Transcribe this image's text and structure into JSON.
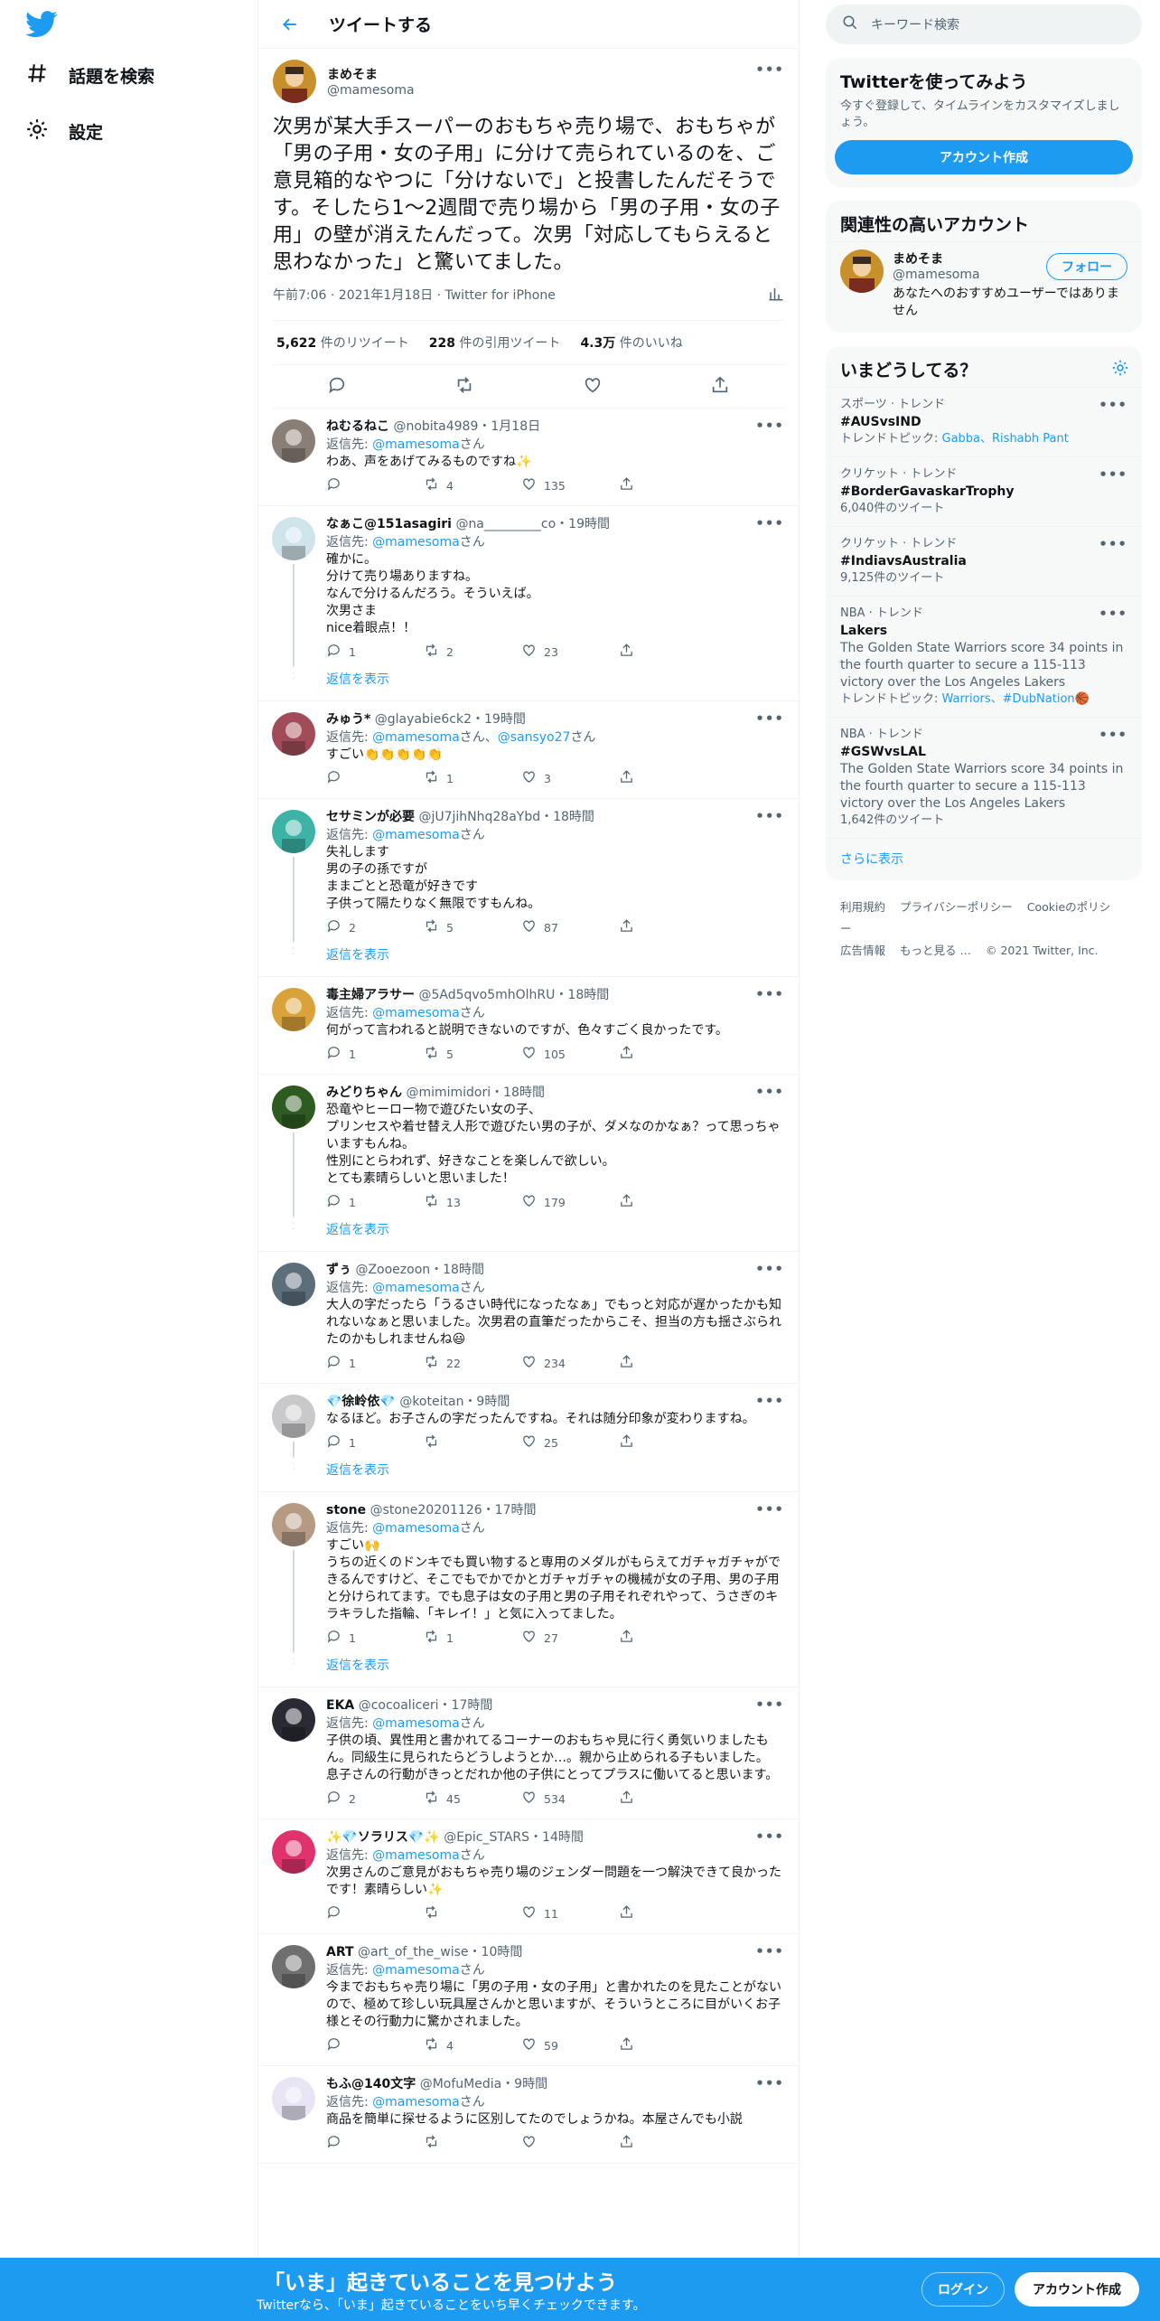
{
  "nav": {
    "explore_label": "話題を検索",
    "settings_label": "設定"
  },
  "header": {
    "title": "ツイートする"
  },
  "tweet": {
    "name": "まめそま",
    "handle": "@mamesoma",
    "text": "次男が某大手スーパーのおもちゃ売り場で、おもちゃが「男の子用・女の子用」に分けて売られているのを、ご意見箱的なやつに「分けないで」と投書したんだそうです。そしたら1〜2週間で売り場から「男の子用・女の子用」の壁が消えたんだって。次男「対応してもらえると思わなかった」と驚いてました。",
    "time": "午前7:06 · 2021年1月18日 · Twitter for iPhone",
    "retweets_count": "5,622",
    "retweets_label": "件のリツイート",
    "quotes_count": "228",
    "quotes_label": "件の引用ツイート",
    "likes_count": "4.3万",
    "likes_label": "件のいいね"
  },
  "replies": [
    {
      "name": "ねむるねこ",
      "handle": "@nobita4989",
      "time": "・1月18日",
      "reply_to": "返信先: @mamesomaさん",
      "text": "わあ、声をあげてみるものですね✨",
      "replies": "",
      "retweets": "4",
      "likes": "135",
      "show_more": ""
    },
    {
      "name": "なぁこ@151asagiri",
      "handle": "@na_________co",
      "time": "・19時間",
      "reply_to": "返信先: @mamesomaさん",
      "text": "確かに。\n分けて売り場ありますね。\nなんで分けるんだろう。そういえば。\n次男さま\nnice着眼点！！",
      "replies": "1",
      "retweets": "2",
      "likes": "23",
      "show_more": "返信を表示"
    },
    {
      "name": "みゅう*",
      "handle": "@glayabie6ck2",
      "time": "・19時間",
      "reply_to": "返信先: @mamesomaさん、@sansyo27さん",
      "text": "すごい👏👏👏👏👏",
      "replies": "",
      "retweets": "1",
      "likes": "3",
      "show_more": ""
    },
    {
      "name": "セサミンが必要",
      "handle": "@jU7jihNhq28aYbd",
      "time": "・18時間",
      "reply_to": "返信先: @mamesomaさん",
      "text": "失礼します\n男の子の孫ですが\nままごとと恐竜が好きです\n子供って隔たりなく無限ですもんね。",
      "replies": "2",
      "retweets": "5",
      "likes": "87",
      "show_more": "返信を表示"
    },
    {
      "name": "毒主婦アラサー",
      "handle": "@5Ad5qvo5mhOlhRU",
      "time": "・18時間",
      "reply_to": "返信先: @mamesomaさん",
      "text": "何がって言われると説明できないのですが、色々すごく良かったです。",
      "replies": "1",
      "retweets": "5",
      "likes": "105",
      "show_more": ""
    },
    {
      "name": "みどりちゃん",
      "handle": "@mimimidori",
      "time": "・18時間",
      "reply_to": "",
      "text": "恐竜やヒーロー物で遊びたい女の子、\nプリンセスや着せ替え人形で遊びたい男の子が、ダメなのかなぁ？って思っちゃいますもんね。\n性別にとらわれず、好きなことを楽しんで欲しい。\nとても素晴らしいと思いました！",
      "replies": "1",
      "retweets": "13",
      "likes": "179",
      "show_more": "返信を表示"
    },
    {
      "name": "ずぅ",
      "handle": "@Zooezoon",
      "time": "・18時間",
      "reply_to": "返信先: @mamesomaさん",
      "text": "大人の字だったら「うるさい時代になったなぁ」でもっと対応が遅かったかも知れないなぁと思いました。次男君の直筆だったからこそ、担当の方も揺さぶられたのかもしれませんね😃",
      "replies": "1",
      "retweets": "22",
      "likes": "234",
      "show_more": ""
    },
    {
      "name": "💎徐岭依💎",
      "handle": "@koteitan",
      "time": "・9時間",
      "reply_to": "",
      "text": "なるほど。お子さんの字だったんですね。それは随分印象が変わりますね。",
      "replies": "1",
      "retweets": "",
      "likes": "25",
      "show_more": "返信を表示"
    },
    {
      "name": "stone",
      "handle": "@stone20201126",
      "time": "・17時間",
      "reply_to": "返信先: @mamesomaさん",
      "text": "すごい🙌\nうちの近くのドンキでも買い物すると専用のメダルがもらえてガチャガチャができるんですけど、そこでもでかでかとガチャガチャの機械が女の子用、男の子用と分けられてます。でも息子は女の子用と男の子用それぞれやって、うさぎのキラキラした指輪、「キレイ！」と気に入ってました。",
      "replies": "1",
      "retweets": "1",
      "likes": "27",
      "show_more": "返信を表示"
    },
    {
      "name": "EKA",
      "handle": "@cocoaliceri",
      "time": "・17時間",
      "reply_to": "返信先: @mamesomaさん",
      "text": "子供の頃、異性用と書かれてるコーナーのおもちゃ見に行く勇気いりましたもん。同級生に見られたらどうしようとか…。親から止められる子もいました。\n息子さんの行動がきっとだれか他の子供にとってプラスに働いてると思います。",
      "replies": "2",
      "retweets": "45",
      "likes": "534",
      "show_more": ""
    },
    {
      "name": "✨💎ソラリス💎✨",
      "handle": "@Epic_STARS",
      "time": "・14時間",
      "reply_to": "返信先: @mamesomaさん",
      "text": "次男さんのご意見がおもちゃ売り場のジェンダー問題を一つ解決できて良かったです！素晴らしい✨",
      "replies": "",
      "retweets": "",
      "likes": "11",
      "show_more": ""
    },
    {
      "name": "ART",
      "handle": "@art_of_the_wise",
      "time": "・10時間",
      "reply_to": "返信先: @mamesomaさん",
      "text": "今までおもちゃ売り場に「男の子用・女の子用」と書かれたのを見たことがないので、極めて珍しい玩具屋さんかと思いますが、そういうところに目がいくお子様とその行動力に驚かされました。",
      "replies": "",
      "retweets": "4",
      "likes": "59",
      "show_more": ""
    },
    {
      "name": "もふ@140文字",
      "handle": "@MofuMedia",
      "time": "・9時間",
      "reply_to": "返信先: @mamesomaさん",
      "text": "商品を簡単に探せるように区別してたのでしょうかね。本屋さんでも小説",
      "replies": "",
      "retweets": "",
      "likes": "",
      "show_more": ""
    }
  ],
  "sidebar": {
    "search_placeholder": "キーワード検索",
    "signup_title": "Twitterを使ってみよう",
    "signup_sub": "今すぐ登録して、タイムラインをカスタマイズしましょう。",
    "signup_button": "アカウント作成",
    "related_title": "関連性の高いアカウント",
    "related_name": "まめそま",
    "related_handle": "@mamesoma",
    "follow_button": "フォロー",
    "related_bio": "あなたへのおすすめユーザーではありません",
    "trends_title": "いまどうしてる？",
    "trends": [
      {
        "category": "スポーツ · トレンド",
        "name": "#AUSvsIND",
        "desc": "",
        "topic_label": "トレンドトピック: ",
        "topics": "Gabba、Rishabh Pant",
        "count": ""
      },
      {
        "category": "クリケット · トレンド",
        "name": "#BorderGavaskarTrophy",
        "desc": "",
        "topic_label": "",
        "topics": "",
        "count": "6,040件のツイート"
      },
      {
        "category": "クリケット · トレンド",
        "name": "#IndiavsAustralia",
        "desc": "",
        "topic_label": "",
        "topics": "",
        "count": "9,125件のツイート"
      },
      {
        "category": "NBA · トレンド",
        "name": "Lakers",
        "desc": "The Golden State Warriors score 34 points in the fourth quarter to secure a 115-113 victory over the Los Angeles Lakers",
        "topic_label": "トレンドトピック: ",
        "topics": "Warriors、#DubNation🏀",
        "count": ""
      },
      {
        "category": "NBA · トレンド",
        "name": "#GSWvsLAL",
        "desc": "The Golden State Warriors score 34 points in the fourth quarter to secure a 115-113 victory over the Los Angeles Lakers",
        "topic_label": "",
        "topics": "",
        "count": "1,642件のツイート"
      }
    ],
    "show_more": "さらに表示",
    "footer_1": "利用規約",
    "footer_2": "プライバシーポリシー",
    "footer_3": "Cookieのポリシー",
    "footer_4": "広告情報",
    "footer_5": "もっと見る …",
    "footer_6": "© 2021 Twitter, Inc."
  },
  "bottom_bar": {
    "title": "「いま」起きていることを見つけよう",
    "subtitle": "Twitterなら、「いま」起きていることをいち早くチェックできます。",
    "login_button": "ログイン",
    "signup_button": "アカウント作成"
  },
  "colors": {
    "accent": "#1d9bf0",
    "secondary_text": "#536471",
    "border": "#eff3f4"
  }
}
